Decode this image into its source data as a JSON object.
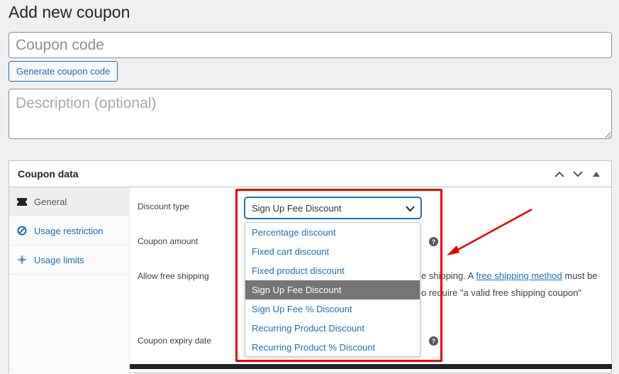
{
  "page": {
    "title": "Add new coupon"
  },
  "coupon_code": {
    "placeholder": "Coupon code",
    "value": ""
  },
  "generate_button": {
    "label": "Generate coupon code"
  },
  "description": {
    "placeholder": "Description (optional)",
    "value": ""
  },
  "panel": {
    "title": "Coupon data",
    "controls": [
      "chevron-up-icon",
      "chevron-down-icon",
      "triangle-up-icon"
    ]
  },
  "tabs": [
    {
      "label": "General",
      "icon": "ticket-icon",
      "active": true
    },
    {
      "label": "Usage restriction",
      "icon": "ban-icon",
      "active": false
    },
    {
      "label": "Usage limits",
      "icon": "plus-sparkle-icon",
      "active": false
    }
  ],
  "fields": {
    "discount_type_label": "Discount type",
    "coupon_amount_label": "Coupon amount",
    "allow_free_shipping_label": "Allow free shipping",
    "coupon_expiry_label": "Coupon expiry date"
  },
  "discount_type": {
    "selected": "Sign Up Fee Discount",
    "options": [
      "Percentage discount",
      "Fixed cart discount",
      "Fixed product discount",
      "Sign Up Fee Discount",
      "Sign Up Fee % Discount",
      "Recurring Product Discount",
      "Recurring Product % Discount"
    ]
  },
  "free_shipping_text": {
    "line1_pre": "e shipping. A ",
    "line1_link": "free shipping method",
    "line1_post": " must be",
    "line2": "o require \"a valid free shipping coupon\""
  },
  "help_icon_glyph": "?",
  "colors": {
    "accent": "#2271b1",
    "selected_option_bg": "#757575",
    "annotation_red": "#e60000"
  }
}
